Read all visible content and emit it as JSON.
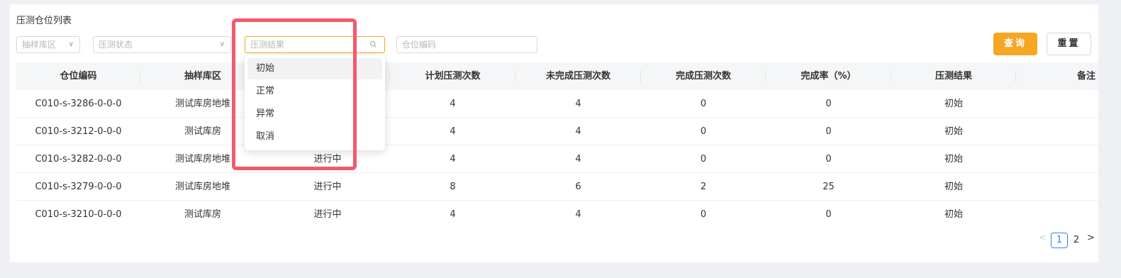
{
  "title": "压测仓位列表",
  "filters": {
    "area_placeholder": "抽样库区",
    "status_placeholder": "压测状态",
    "result_placeholder": "压测结果",
    "code_placeholder": "仓位编码"
  },
  "buttons": {
    "query": "查询",
    "reset": "重置"
  },
  "columns": [
    "仓位编码",
    "抽样库区",
    "",
    "计划压测次数",
    "未完成压测次数",
    "完成压测次数",
    "完成率（%）",
    "压测结果",
    "备注"
  ],
  "rows": [
    [
      "C010-s-3286-0-0-0",
      "测试库房地堆",
      "",
      "4",
      "4",
      "0",
      "0",
      "初始",
      ""
    ],
    [
      "C010-s-3212-0-0-0",
      "测试库房",
      "",
      "4",
      "4",
      "0",
      "0",
      "初始",
      ""
    ],
    [
      "C010-s-3282-0-0-0",
      "测试库房地堆",
      "进行中",
      "4",
      "4",
      "0",
      "0",
      "初始",
      ""
    ],
    [
      "C010-s-3279-0-0-0",
      "测试库房地堆",
      "进行中",
      "8",
      "6",
      "2",
      "25",
      "初始",
      ""
    ],
    [
      "C010-s-3210-0-0-0",
      "测试库房",
      "进行中",
      "4",
      "4",
      "0",
      "0",
      "初始",
      ""
    ]
  ],
  "dropdown_options": [
    "初始",
    "正常",
    "异常",
    "取消"
  ],
  "pagination": {
    "current": "1",
    "next_page": "2",
    "prev": "<",
    "next": ">"
  },
  "colors": {
    "accent": "#f5a623",
    "highlight_box": "#f35a6e",
    "page_active": "#3a7afe"
  },
  "icons": {
    "caret": "chevron-down-icon",
    "search": "search-icon"
  }
}
